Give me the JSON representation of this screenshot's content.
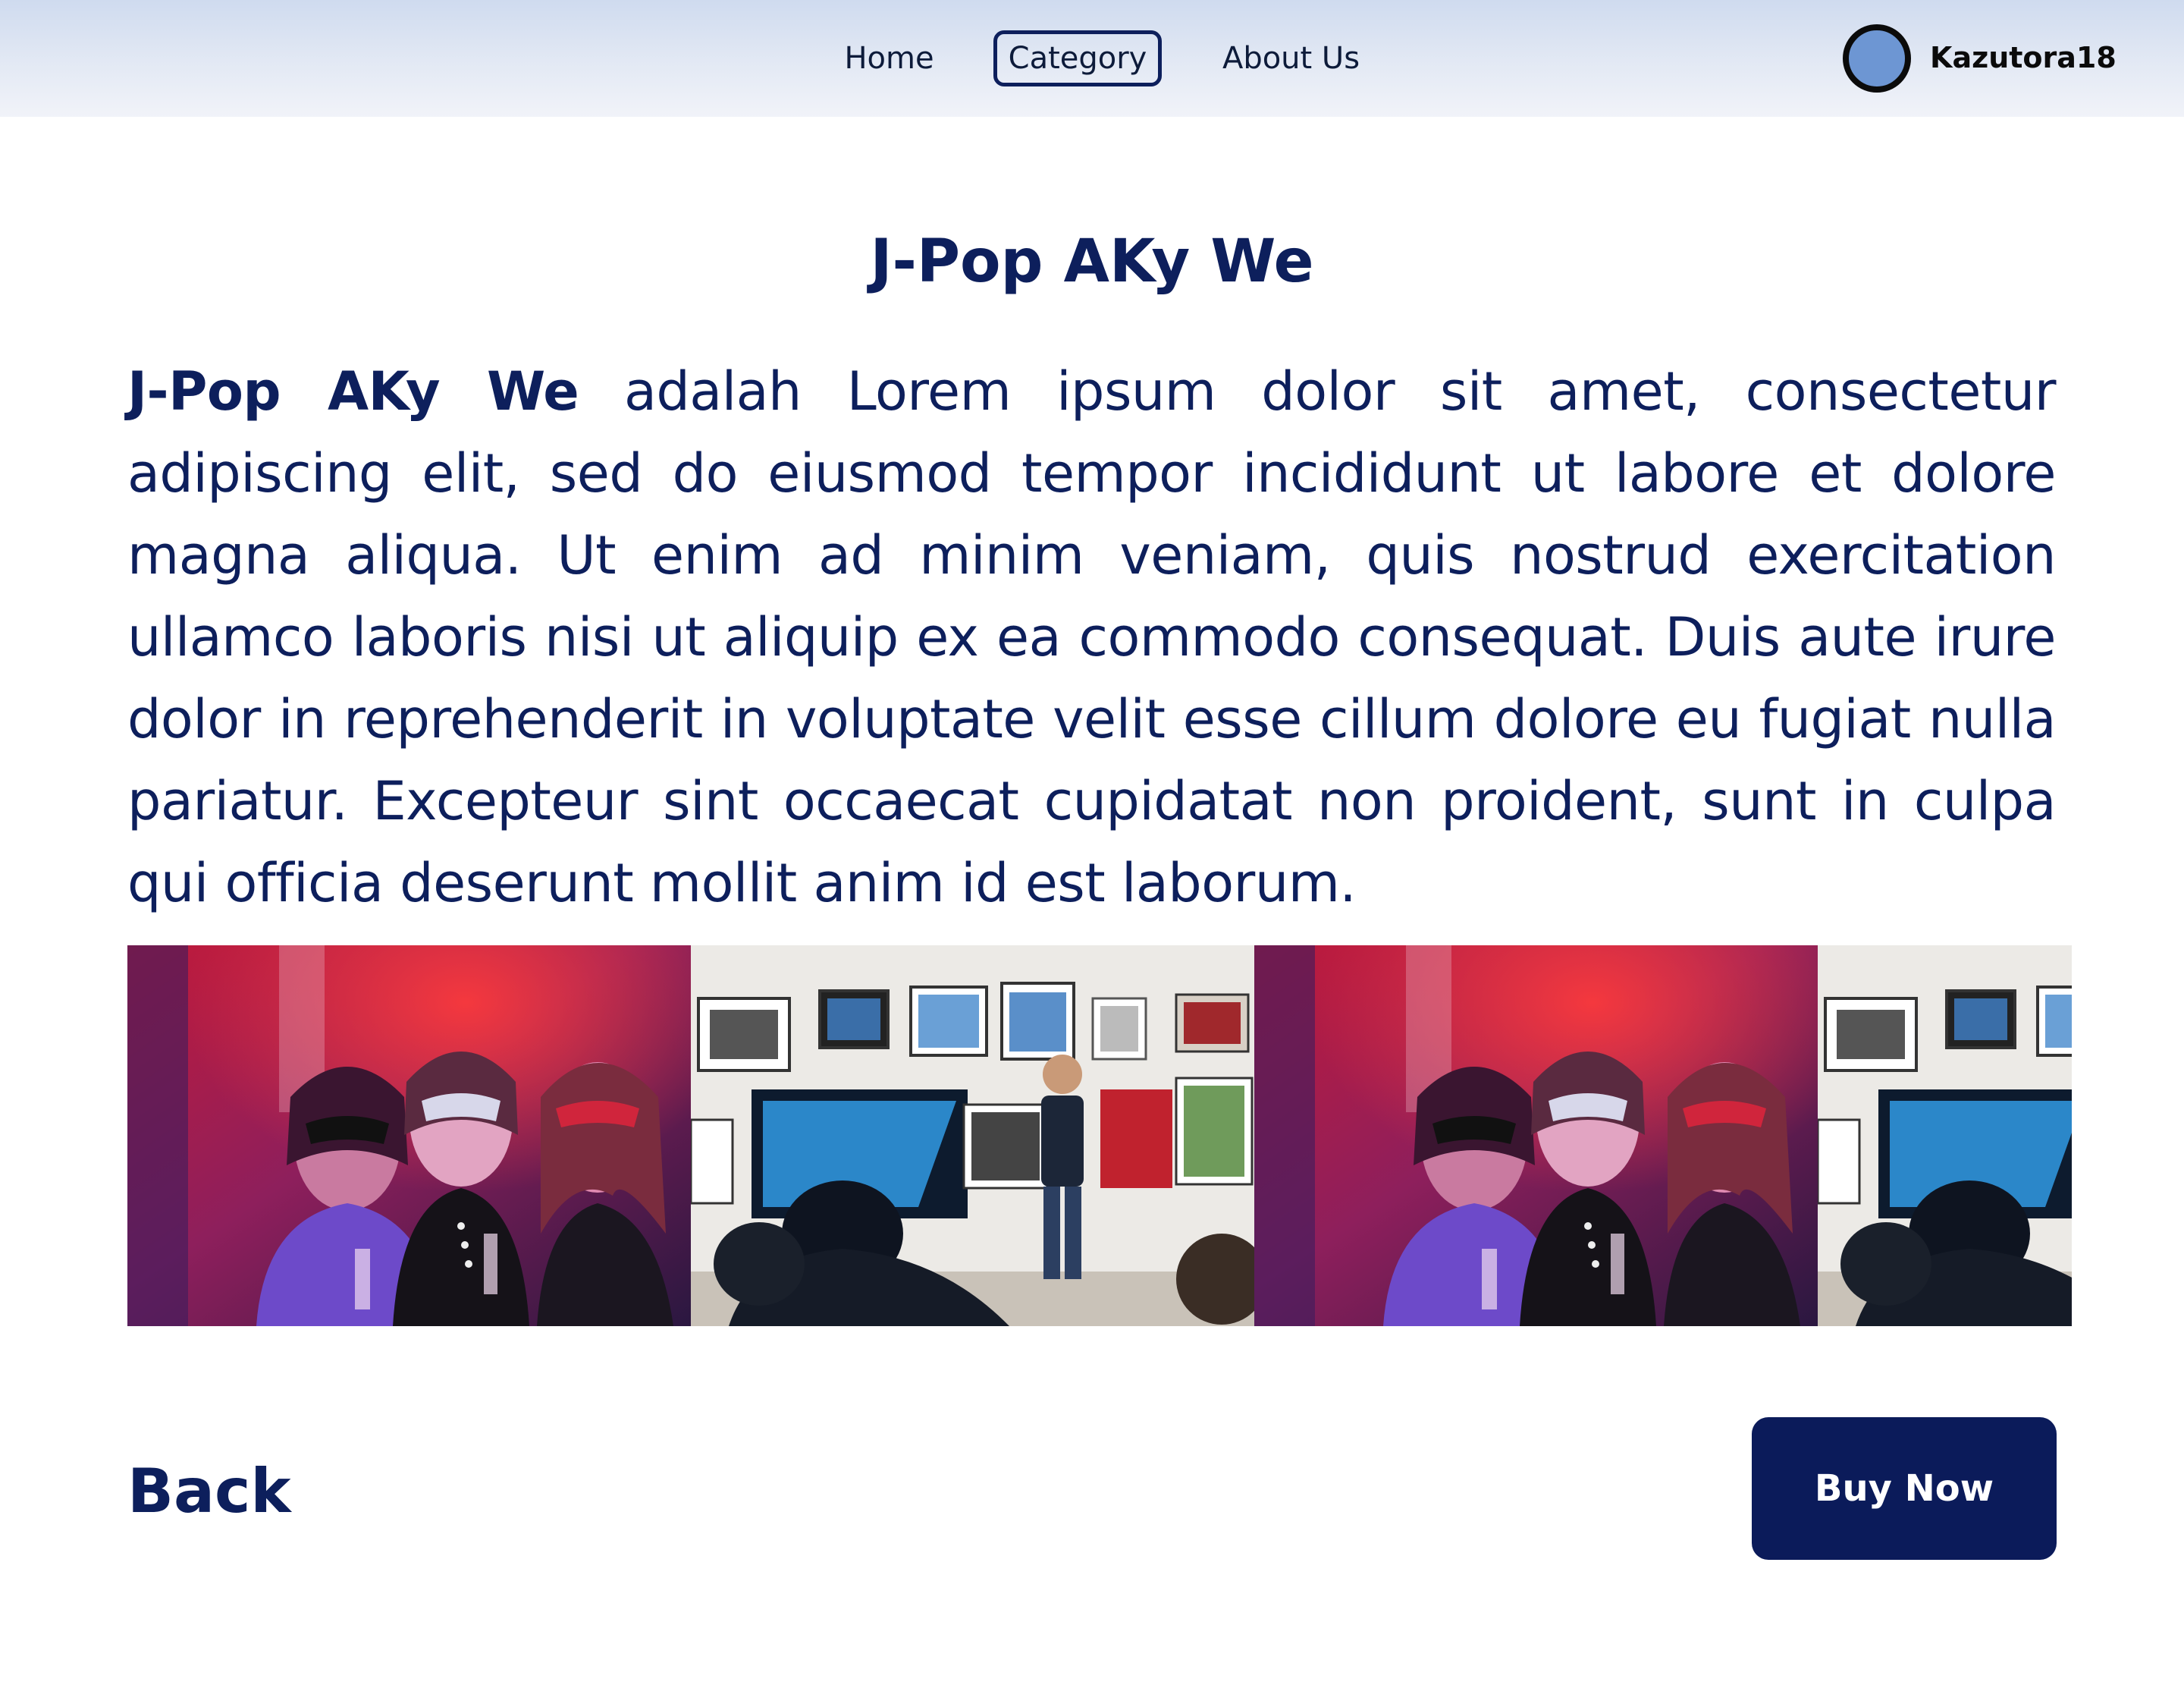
{
  "nav": {
    "home": "Home",
    "category": "Category",
    "about": "About Us",
    "active": "category"
  },
  "user": {
    "name": "Kazutora18",
    "avatar_color": "#6d96d3"
  },
  "event": {
    "title": "J-Pop AKy We",
    "description_lead": "J-Pop AKy We",
    "description_body": " adalah Lorem ipsum dolor sit amet, consectetur adipiscing elit, sed do eiusmod tempor incididunt ut labore et dolore magna aliqua. Ut enim ad minim veniam, quis nostrud exercitation ullamco laboris nisi ut aliquip ex ea commodo consequat. Duis aute irure dolor in reprehenderit in voluptate velit esse cillum dolore eu fugiat nulla pariatur. Excepteur sint occaecat cupidatat non proident, sunt in culpa qui officia deserunt mollit anim id est laborum."
  },
  "gallery": [
    {
      "subject": "masquerade-party-photo"
    },
    {
      "subject": "gallery-exhibition-photo"
    },
    {
      "subject": "masquerade-party-photo"
    },
    {
      "subject": "gallery-exhibition-photo"
    }
  ],
  "actions": {
    "back": "Back",
    "buy": "Buy Now"
  },
  "colors": {
    "primary": "#0b1b5a",
    "text": "#0d1f5c",
    "header_gradient_top": "#cfdbef"
  }
}
